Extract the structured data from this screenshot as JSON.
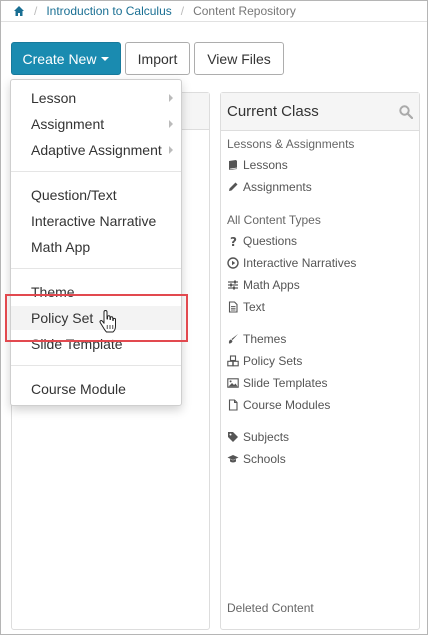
{
  "breadcrumb": {
    "home_icon": "home-icon",
    "items": [
      "Introduction to Calculus",
      "Content Repository"
    ],
    "separator": "/"
  },
  "toolbar": {
    "create_new_label": "Create New",
    "import_label": "Import",
    "view_files_label": "View Files"
  },
  "dropdown": {
    "items": [
      {
        "label": "Lesson",
        "submenu": true
      },
      {
        "label": "Assignment",
        "submenu": true
      },
      {
        "label": "Adaptive Assignment",
        "submenu": true
      },
      {
        "label": "Question/Text"
      },
      {
        "label": "Interactive Narrative"
      },
      {
        "label": "Math App"
      },
      {
        "label": "Theme"
      },
      {
        "label": "Policy Set",
        "hovered": true
      },
      {
        "label": "Slide Template"
      },
      {
        "label": "Course Module"
      }
    ]
  },
  "current_class": {
    "title": "Current Class",
    "search_icon": "search-icon",
    "sections": [
      {
        "heading": "Lessons & Assignments",
        "items": [
          {
            "label": "Lessons",
            "icon": "book-icon"
          },
          {
            "label": "Assignments",
            "icon": "pencil-icon"
          }
        ]
      },
      {
        "heading": "All Content Types",
        "items": [
          {
            "label": "Questions",
            "icon": "question-icon"
          },
          {
            "label": "Interactive Narratives",
            "icon": "play-circle-icon"
          },
          {
            "label": "Math Apps",
            "icon": "sliders-icon"
          },
          {
            "label": "Text",
            "icon": "file-text-icon"
          }
        ]
      },
      {
        "heading": "",
        "items": [
          {
            "label": "Themes",
            "icon": "brush-icon"
          },
          {
            "label": "Policy Sets",
            "icon": "cubes-icon"
          },
          {
            "label": "Slide Templates",
            "icon": "image-icon"
          },
          {
            "label": "Course Modules",
            "icon": "file-icon"
          }
        ]
      },
      {
        "heading": "",
        "items": [
          {
            "label": "Subjects",
            "icon": "tag-icon"
          },
          {
            "label": "Schools",
            "icon": "graduation-cap-icon"
          }
        ]
      }
    ],
    "footer": "Deleted Content"
  },
  "colors": {
    "primary": "#1a8bb0",
    "highlight_border": "#e2494f",
    "link": "#1a6f93"
  }
}
